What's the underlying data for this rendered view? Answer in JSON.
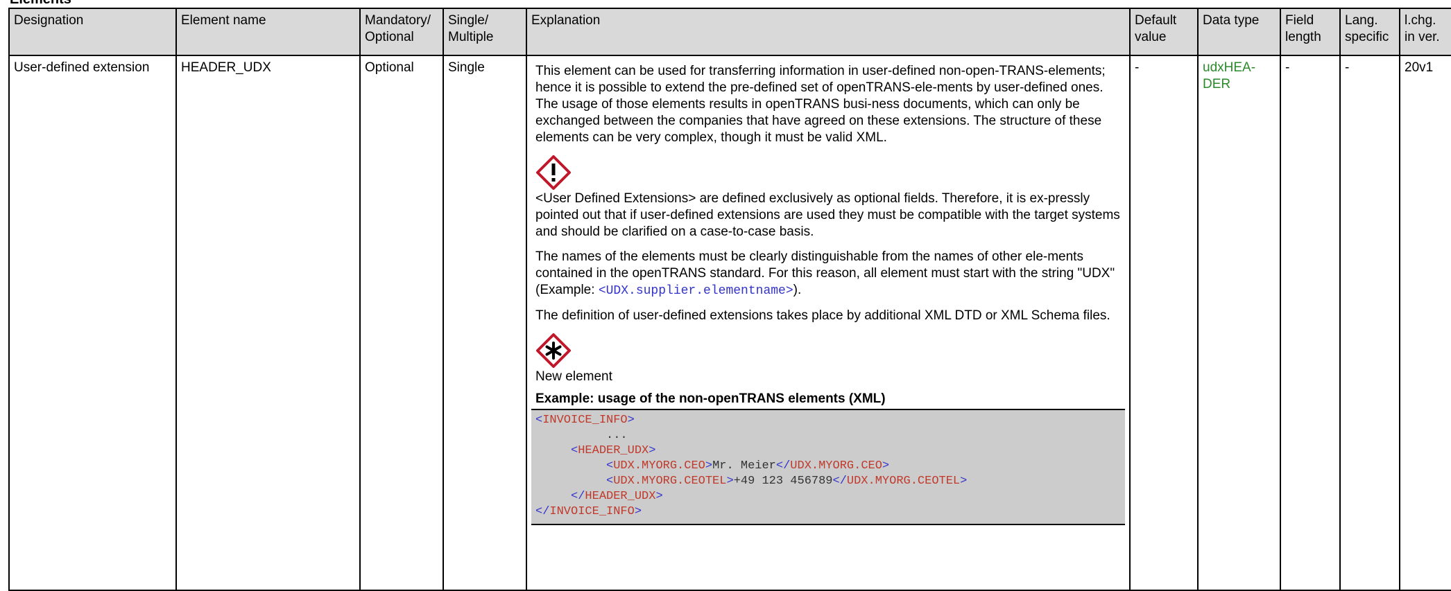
{
  "section_heading": "Elements",
  "columns": {
    "designation": "Designation",
    "element_name": "Element name",
    "mandatory_optional": "Mandatory/ Optional",
    "single_multiple": "Single/ Multiple",
    "explanation": "Explanation",
    "default_value": "Default value",
    "data_type": "Data type",
    "field_length": "Field length",
    "lang_specific": "Lang. specific",
    "last_change": "l.chg. in ver."
  },
  "row": {
    "designation": "User-defined extension",
    "element_name": "HEADER_UDX",
    "mandatory_optional": "Optional",
    "single_multiple": "Single",
    "default_value": "-",
    "data_type": "udxHEA-DER",
    "field_length": "-",
    "lang_specific": "-",
    "last_change": "20v1",
    "explanation": {
      "para1": "This element can be used for transferring information in user-defined non-open-TRANS-elements; hence it is possible to extend the pre-defined set of openTRANS-ele-ments by user-defined ones. The usage of those elements results in openTRANS busi-ness documents, which can only be exchanged between the companies that have agreed on these extensions. The structure of these elements can be very complex, though it must be valid XML.",
      "warning_text": "<User Defined Extensions> are defined exclusively as optional fields. Therefore, it is ex-pressly pointed out that if user-defined extensions are used they must be compatible with the target systems and should be clarified on a case-to-case basis.",
      "para3_before": "The names of the elements must be clearly distinguishable from the names of other ele-ments contained in the openTRANS standard. For this reason, all element must start with the string \"UDX\" (Example: ",
      "para3_code": "<UDX.supplier.elementname>",
      "para3_after": ").",
      "para4": "The definition of user-defined extensions takes place by additional XML DTD or XML Schema files.",
      "new_element_text": "New element",
      "example_title": "Example: usage of the non-openTRANS elements (XML)",
      "code": {
        "invoice_info": "INVOICE_INFO",
        "dots": "...",
        "header_udx": "HEADER_UDX",
        "ceo_tag": "UDX.MYORG.CEO",
        "ceo_value": "Mr. Meier",
        "ceotel_tag": "UDX.MYORG.CEOTEL",
        "ceotel_value": "+49 123 456789"
      }
    }
  },
  "icons": {
    "warning": "exclamation-diamond-icon",
    "new": "asterisk-diamond-icon"
  },
  "colors": {
    "header_bg": "#d9d9d9",
    "data_type_green": "#2a8a2a",
    "code_bg": "#cccccc",
    "xml_tag_red": "#c0392b",
    "xml_bracket_blue": "#3333cc",
    "icon_red": "#c0182b"
  }
}
